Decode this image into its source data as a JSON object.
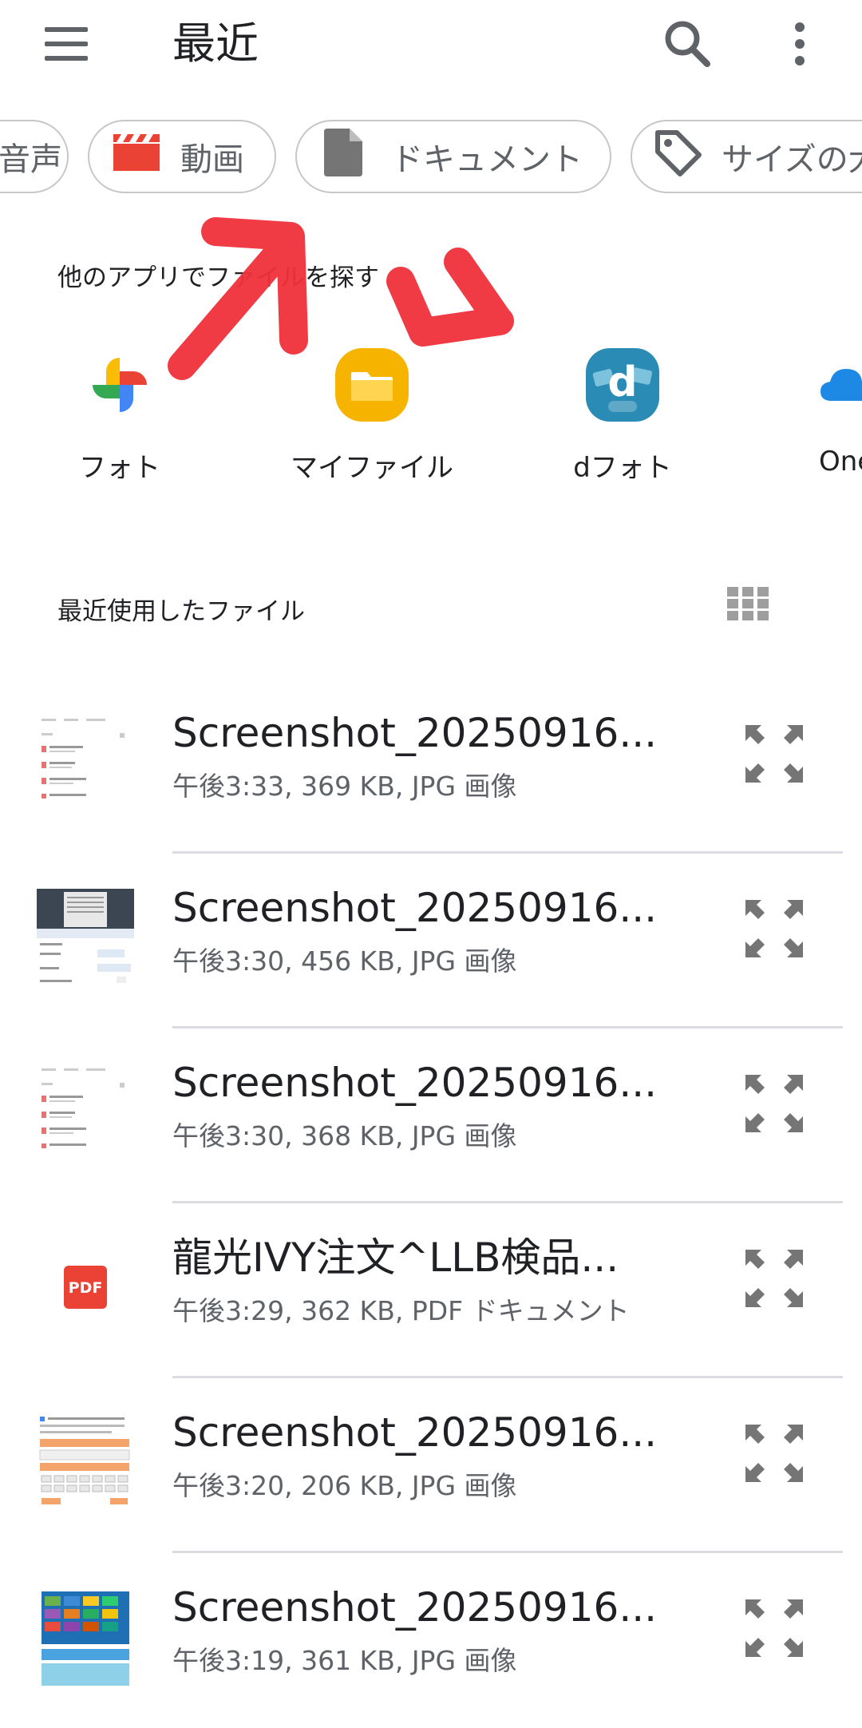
{
  "app_bar": {
    "title": "最近",
    "menu_icon": "menu-icon",
    "search_icon": "search-icon",
    "more_icon": "more-vert-icon"
  },
  "chips": [
    {
      "label": "音声",
      "icon": "audio-icon"
    },
    {
      "label": "動画",
      "icon": "video-icon"
    },
    {
      "label": "ドキュメント",
      "icon": "document-icon"
    },
    {
      "label": "サイズの大",
      "icon": "tag-icon"
    }
  ],
  "other_apps": {
    "heading": "他のアプリでファイルを探す",
    "apps": [
      {
        "label": "フォト",
        "icon": "google-photos-icon"
      },
      {
        "label": "マイファイル",
        "icon": "my-files-icon"
      },
      {
        "label": "dフォト",
        "icon": "d-photo-icon"
      },
      {
        "label": "One",
        "icon": "onedrive-icon"
      }
    ]
  },
  "recent": {
    "heading": "最近使用したファイル",
    "grid_icon": "grid-view-icon",
    "files": [
      {
        "name": "Screenshot_20250916...",
        "meta": "午後3:33, 369 KB, JPG 画像",
        "thumb": "screenshot-list"
      },
      {
        "name": "Screenshot_20250916...",
        "meta": "午後3:30, 456 KB, JPG 画像",
        "thumb": "screenshot-dark-header"
      },
      {
        "name": "Screenshot_20250916...",
        "meta": "午後3:30, 368 KB, JPG 画像",
        "thumb": "screenshot-list"
      },
      {
        "name": "龍光IVY注文^LLB検品...",
        "meta": "午後3:29, 362 KB, PDF ドキュメント",
        "thumb": "pdf-icon"
      },
      {
        "name": "Screenshot_20250916...",
        "meta": "午後3:20, 206 KB, JPG 画像",
        "thumb": "screenshot-form"
      },
      {
        "name": "Screenshot_20250916...",
        "meta": "午後3:19, 361 KB, JPG 画像",
        "thumb": "screenshot-colorful"
      }
    ]
  },
  "colors": {
    "accent_red": "#ea4335",
    "annotation_red": "#f0313b",
    "text_primary": "#202124",
    "text_secondary": "#5f6368",
    "divider": "#dadce0",
    "chip_border": "#c7c7c7"
  }
}
